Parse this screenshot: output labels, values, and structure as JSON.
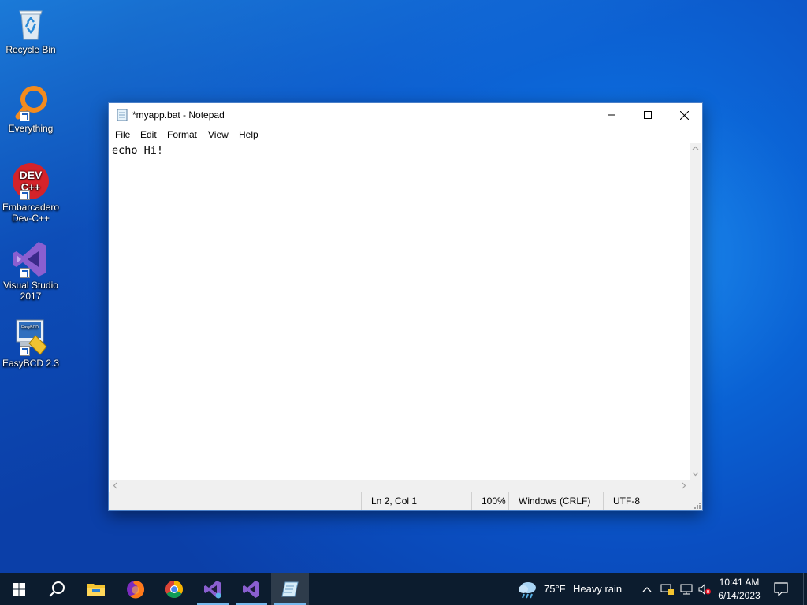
{
  "desktop": {
    "icons": [
      {
        "name": "recycle-bin",
        "label": "Recycle Bin"
      },
      {
        "name": "everything",
        "label": "Everything"
      },
      {
        "name": "devcpp",
        "label_line1": "Embarcadero",
        "label_line2": "Dev-C++",
        "logo_line1": "DEV",
        "logo_line2": "C++"
      },
      {
        "name": "visual-studio",
        "label_line1": "Visual Studio",
        "label_line2": "2017"
      },
      {
        "name": "easybcd",
        "label": "EasyBCD 2.3",
        "screen_text": "EasyBCD"
      }
    ]
  },
  "window": {
    "title": "*myapp.bat - Notepad",
    "menu": [
      "File",
      "Edit",
      "Format",
      "View",
      "Help"
    ],
    "content_line1": "echo Hi!",
    "status": {
      "position": "Ln 2, Col 1",
      "zoom": "100%",
      "line_ending": "Windows (CRLF)",
      "encoding": "UTF-8"
    }
  },
  "taskbar": {
    "weather_temp": "75°F",
    "weather_desc": "Heavy rain",
    "time": "10:41 AM",
    "date": "6/14/2023"
  },
  "colors": {
    "accent": "#0078d7",
    "taskbar": "#0c1c2e",
    "desktop": "#0a62d4"
  }
}
